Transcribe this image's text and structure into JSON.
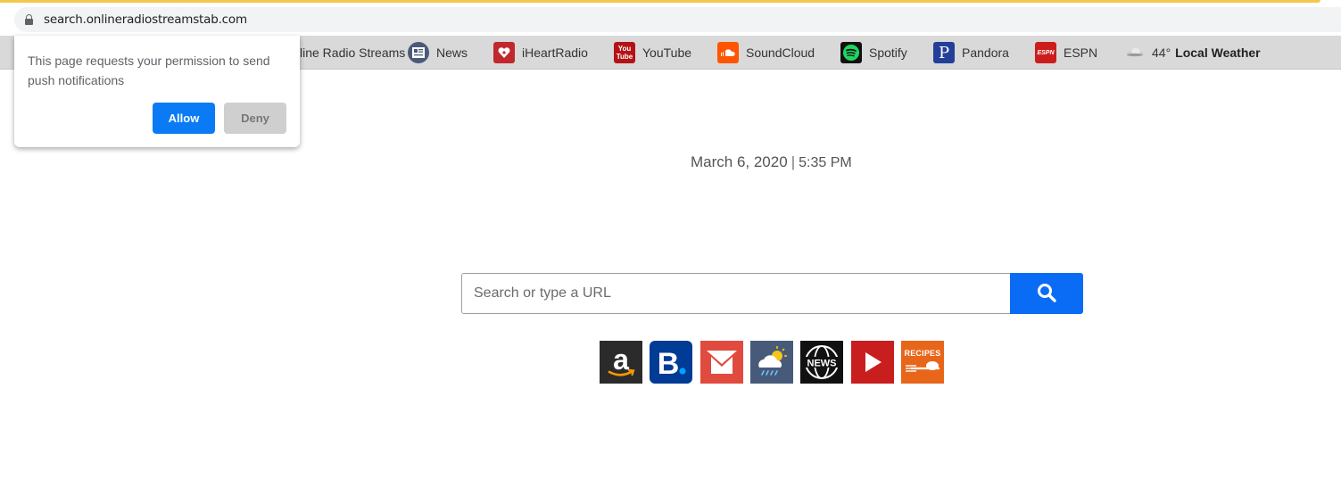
{
  "browser": {
    "url": "search.onlineradiostreamstab.com"
  },
  "bookmarks": {
    "radio_label": "line Radio Streams",
    "news_label": "News",
    "iheart_label": "iHeartRadio",
    "youtube_label": "YouTube",
    "youtube_icon_top": "You",
    "youtube_icon_bottom": "Tube",
    "soundcloud_label": "SoundCloud",
    "spotify_label": "Spotify",
    "pandora_label": "Pandora",
    "pandora_icon_letter": "P",
    "espn_label": "ESPN",
    "espn_icon_text": "ESPN",
    "weather_temp": "44°",
    "weather_label": "Local Weather"
  },
  "notification_popup": {
    "message": "This page requests your permission to send push notifications",
    "allow_label": "Allow",
    "deny_label": "Deny"
  },
  "main": {
    "date": "March 6, 2020",
    "separator": "|",
    "time": "5:35 PM",
    "search_placeholder": "Search or type a URL"
  },
  "shortcuts": {
    "recipes_label": "RECIPES",
    "news_label": "NEWS",
    "icons": [
      "amazon-icon",
      "booking-icon",
      "gmail-icon",
      "weather-icon",
      "news-icon",
      "video-play-icon",
      "recipes-icon"
    ]
  },
  "colors": {
    "accent_blue": "#0a6cf5",
    "loading_bar": "#f3c84b"
  }
}
